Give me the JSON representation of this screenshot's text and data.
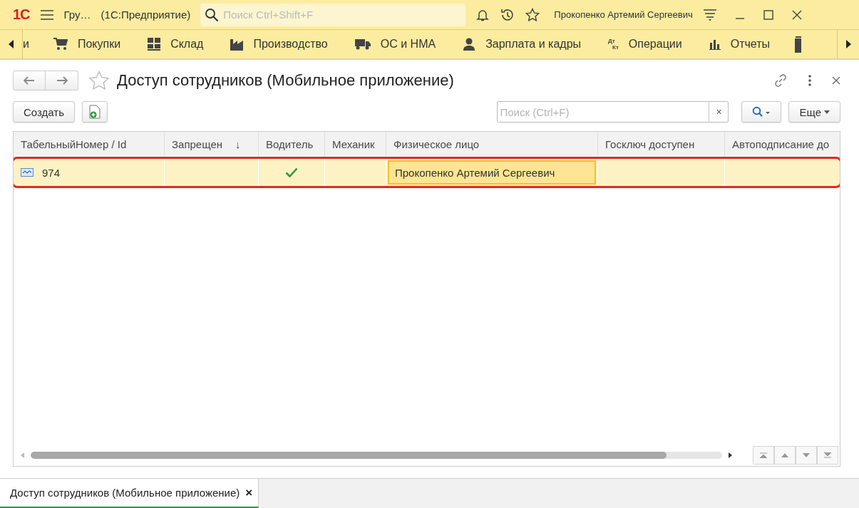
{
  "topbar": {
    "logo": "1С",
    "app_title": "Гру…",
    "app_name": "(1С:Предприятие)",
    "search": {
      "placeholder": "Поиск Ctrl+Shift+F"
    },
    "user": "Прокопенко Артемий Сергеевич"
  },
  "sections": [
    {
      "kind": "none",
      "label": "и"
    },
    {
      "kind": "cart",
      "label": "Покупки"
    },
    {
      "kind": "grid",
      "label": "Склад"
    },
    {
      "kind": "factory",
      "label": "Производство"
    },
    {
      "kind": "truck",
      "label": "ОС и НМА"
    },
    {
      "kind": "person",
      "label": "Зарплата и кадры"
    },
    {
      "kind": "dtkt",
      "label": "Операции",
      "icon_top": "Дт",
      "icon_bottom": "Кт"
    },
    {
      "kind": "chart",
      "label": "Отчеты"
    }
  ],
  "form": {
    "title": "Доступ сотрудников (Мобильное приложение)",
    "favorite": false,
    "create_button": "Создать",
    "search": {
      "placeholder": "Поиск (Ctrl+F)",
      "clear": "×"
    },
    "more_button": "Еще"
  },
  "table": {
    "columns": [
      {
        "label": "ТабельныйНомер / Id"
      },
      {
        "label": "Запрещен",
        "sort_mark": "↓"
      },
      {
        "label": "Водитель"
      },
      {
        "label": "Механик"
      },
      {
        "label": "Физическое лицо"
      },
      {
        "label": "Госключ доступен"
      },
      {
        "label": "Автоподписание до"
      }
    ],
    "rows": [
      {
        "selected": true,
        "highlighted": true,
        "cells": [
          {
            "kind": "id",
            "text": "974"
          },
          {
            "kind": "check",
            "checked": false
          },
          {
            "kind": "check",
            "checked": true
          },
          {
            "kind": "check",
            "checked": false
          },
          {
            "kind": "text",
            "text": "Прокопенко Артемий Сергеевич",
            "focused": true
          },
          {
            "kind": "empty"
          },
          {
            "kind": "empty"
          }
        ]
      }
    ]
  },
  "open_tabs": [
    {
      "label": "Доступ сотрудников (Мобильное приложение)",
      "close": "×",
      "selected": true
    }
  ]
}
